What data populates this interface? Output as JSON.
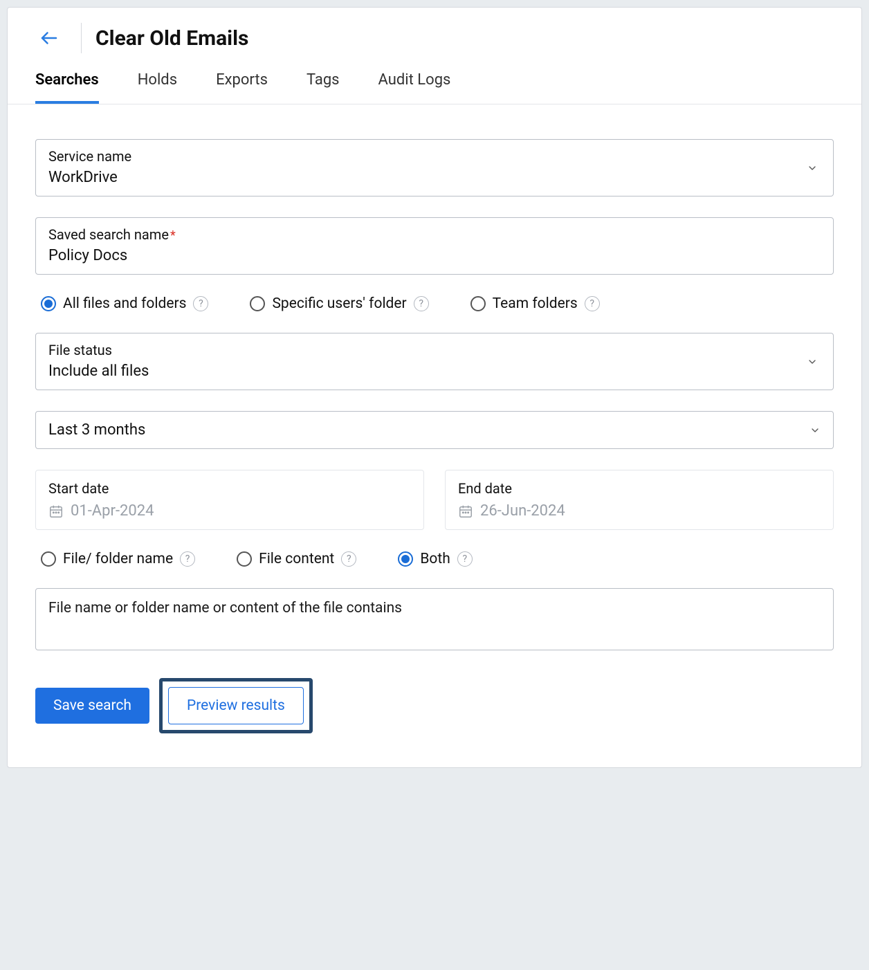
{
  "header": {
    "title": "Clear Old Emails"
  },
  "tabs": [
    {
      "label": "Searches",
      "active": true
    },
    {
      "label": "Holds",
      "active": false
    },
    {
      "label": "Exports",
      "active": false
    },
    {
      "label": "Tags",
      "active": false
    },
    {
      "label": "Audit Logs",
      "active": false
    }
  ],
  "form": {
    "service_name": {
      "label": "Service name",
      "value": "WorkDrive"
    },
    "saved_search": {
      "label": "Saved search name",
      "required": true,
      "value": "Policy Docs"
    },
    "scope_radios": [
      {
        "label": "All files and folders",
        "checked": true
      },
      {
        "label": "Specific users' folder",
        "checked": false
      },
      {
        "label": "Team folders",
        "checked": false
      }
    ],
    "file_status": {
      "label": "File status",
      "value": "Include all files"
    },
    "date_range": {
      "value": "Last 3 months"
    },
    "start_date": {
      "label": "Start date",
      "value": "01-Apr-2024"
    },
    "end_date": {
      "label": "End date",
      "value": "26-Jun-2024"
    },
    "search_in_radios": [
      {
        "label": "File/ folder name",
        "checked": false
      },
      {
        "label": "File content",
        "checked": false
      },
      {
        "label": "Both",
        "checked": true
      }
    ],
    "query": {
      "placeholder": "File name or folder name or content of the file contains",
      "value": ""
    },
    "buttons": {
      "save": "Save search",
      "preview": "Preview results"
    }
  }
}
